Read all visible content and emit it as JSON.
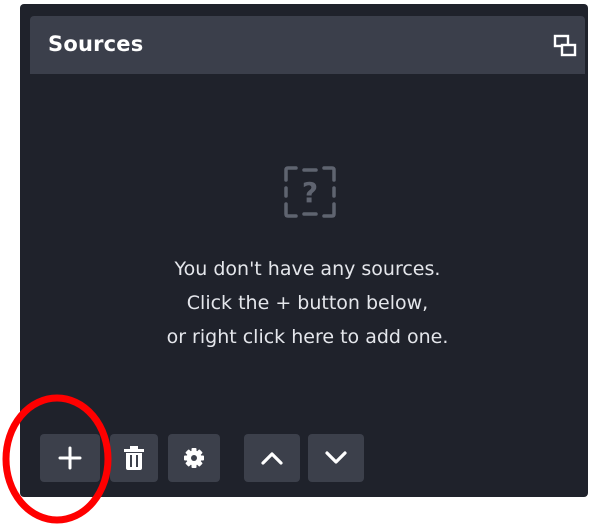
{
  "dock": {
    "title": "Sources",
    "undock_icon": "undock-icon",
    "empty_state": {
      "icon": "question-mark-icon",
      "lines": [
        "You don't have any sources.",
        "Click the + button below,",
        "or right click here to add one."
      ]
    },
    "toolbar": {
      "buttons": [
        {
          "name": "add-source-button",
          "icon": "plus-icon"
        },
        {
          "name": "remove-source-button",
          "icon": "trash-icon"
        },
        {
          "name": "source-properties-button",
          "icon": "gear-icon"
        },
        {
          "name": "move-source-up-button",
          "icon": "chevron-up-icon"
        },
        {
          "name": "move-source-down-button",
          "icon": "chevron-down-icon"
        }
      ]
    }
  },
  "annotation": {
    "color": "#ff0000",
    "shape": "ellipse",
    "target": "add-source-button"
  },
  "colors": {
    "panel_bg": "#1f222b",
    "header_bg": "#3b3f4b",
    "button_bg": "#3c404b",
    "text": "#e4e6eb",
    "icon_muted": "#5f6470"
  }
}
